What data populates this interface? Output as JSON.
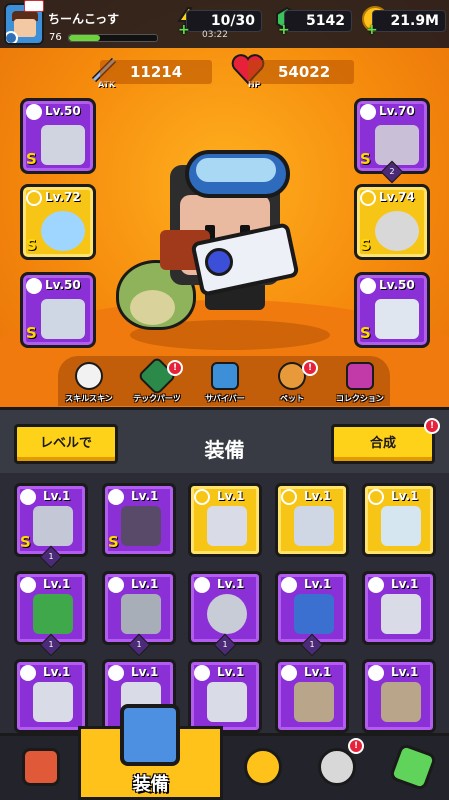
{
  "player": {
    "name": "ちーんこっす",
    "level": "76",
    "xp_fraction": 0.35
  },
  "resources": {
    "energy": "10/30",
    "energy_timer": "03:22",
    "gems": "5142",
    "coins": "21.9M"
  },
  "stats": {
    "atk_label": "ATK",
    "atk": "11214",
    "hp_label": "HP",
    "hp": "54022"
  },
  "equipped": {
    "left": [
      {
        "level": "Lv.50",
        "grade": "S",
        "frame": "purple"
      },
      {
        "level": "Lv.72",
        "grade": "S",
        "frame": "yellow"
      },
      {
        "level": "Lv.50",
        "grade": "S",
        "frame": "purple"
      }
    ],
    "right": [
      {
        "level": "Lv.70",
        "grade": "S",
        "frame": "purple",
        "rank": "2"
      },
      {
        "level": "Lv.74",
        "grade": "S",
        "frame": "yellow"
      },
      {
        "level": "Lv.50",
        "grade": "S",
        "frame": "purple"
      }
    ]
  },
  "quick_menu": [
    {
      "label": "スキルスキン"
    },
    {
      "label": "テックパーツ",
      "badge": "!"
    },
    {
      "label": "サバイバー"
    },
    {
      "label": "ペット",
      "badge": "!"
    },
    {
      "label": "コレクション"
    }
  ],
  "inventory_header": {
    "level_button": "レベルで",
    "title": "装備",
    "merge_button": "合成",
    "merge_badge": "!"
  },
  "inventory": [
    {
      "level": "Lv.1",
      "frame": "purple",
      "grade": "S",
      "rank": "1"
    },
    {
      "level": "Lv.1",
      "frame": "purple",
      "grade": "S"
    },
    {
      "level": "Lv.1",
      "frame": "yellow"
    },
    {
      "level": "Lv.1",
      "frame": "yellow"
    },
    {
      "level": "Lv.1",
      "frame": "yellow"
    },
    {
      "level": "Lv.1",
      "frame": "purple",
      "rank": "1"
    },
    {
      "level": "Lv.1",
      "frame": "purple",
      "rank": "1"
    },
    {
      "level": "Lv.1",
      "frame": "purple",
      "rank": "1"
    },
    {
      "level": "Lv.1",
      "frame": "purple",
      "rank": "1"
    },
    {
      "level": "Lv.1",
      "frame": "purple"
    },
    {
      "level": "Lv.1",
      "frame": "purple"
    },
    {
      "level": "Lv.1",
      "frame": "purple"
    },
    {
      "level": "Lv.1",
      "frame": "purple"
    },
    {
      "level": "Lv.1",
      "frame": "purple"
    },
    {
      "level": "Lv.1",
      "frame": "purple"
    }
  ],
  "nav": {
    "equip_label": "装備",
    "skull_badge": "!"
  },
  "colors": {
    "purple": "#8b2fd6",
    "yellow": "#f7c516",
    "orange": "#f58a0c",
    "alert": "#e8213a"
  }
}
